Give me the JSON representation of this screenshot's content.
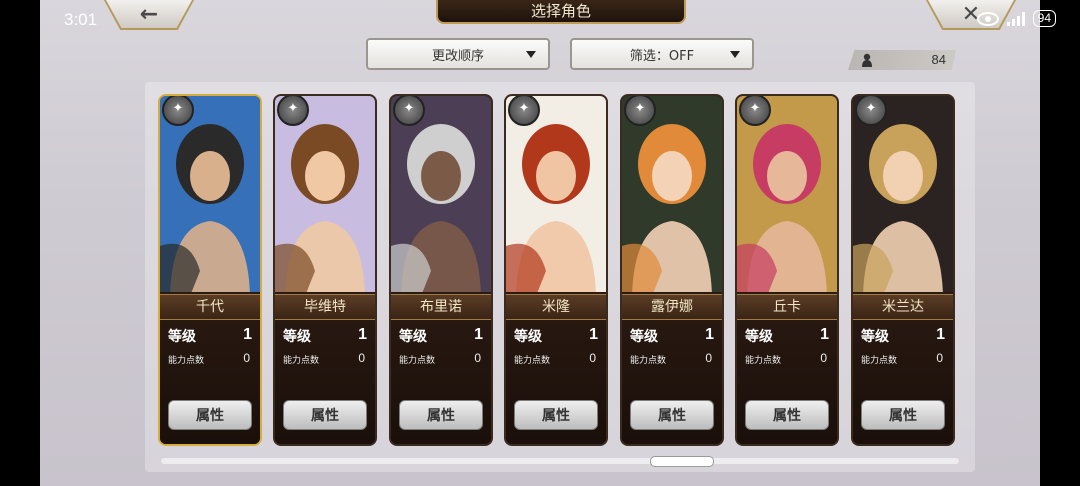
{
  "status": {
    "time": "3:01",
    "battery": "94"
  },
  "header": {
    "title": "选择角色",
    "back_icon": "back-arrow-icon",
    "close_icon": "close-x-icon"
  },
  "controls": {
    "sort_label": "更改顺序",
    "filter_label": "筛选：OFF",
    "character_count": "84"
  },
  "card_labels": {
    "level": "等级",
    "ability_points": "能力点数",
    "attribute_button": "属性"
  },
  "characters": [
    {
      "name": "千代",
      "level": "1",
      "ability_points": "0",
      "weapon": "bow-icon"
    },
    {
      "name": "毕维特",
      "level": "1",
      "ability_points": "0",
      "weapon": "bow-icon"
    },
    {
      "name": "布里诺",
      "level": "1",
      "ability_points": "0",
      "weapon": "sword-icon"
    },
    {
      "name": "米隆",
      "level": "1",
      "ability_points": "0",
      "weapon": "sword-icon"
    },
    {
      "name": "露伊娜",
      "level": "1",
      "ability_points": "0",
      "weapon": "sword-icon"
    },
    {
      "name": "丘卡",
      "level": "1",
      "ability_points": "0",
      "weapon": "axe-icon"
    },
    {
      "name": "米兰达",
      "level": "1",
      "ability_points": "0",
      "weapon": "axe-icon"
    }
  ]
}
